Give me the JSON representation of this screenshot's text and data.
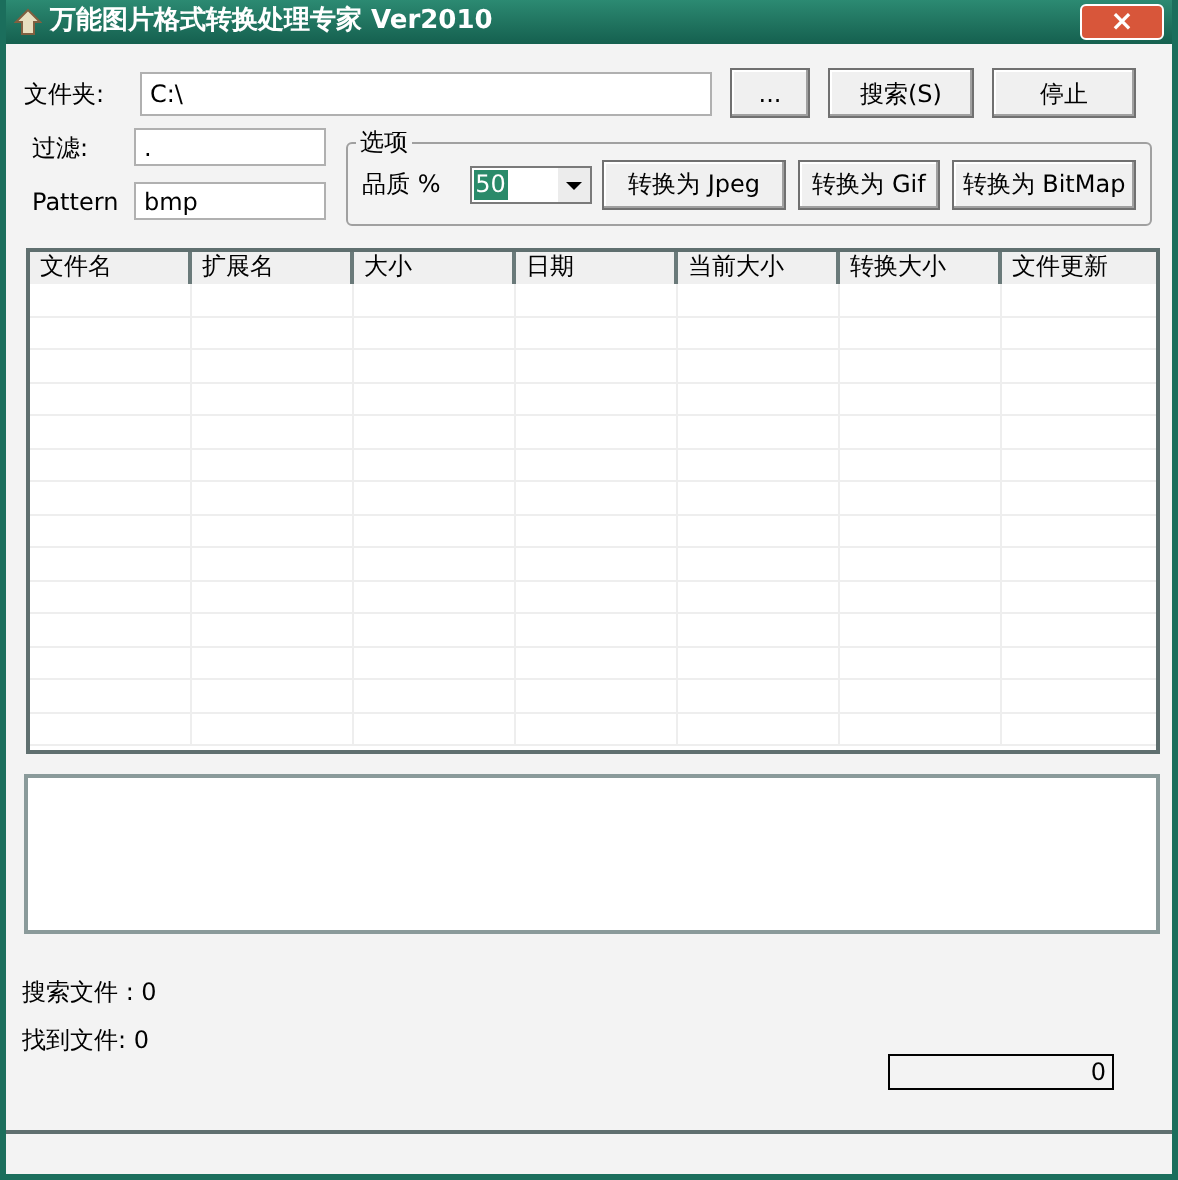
{
  "window": {
    "title": "万能图片格式转换处理专家 Ver2010",
    "close": "×"
  },
  "folder": {
    "label": "文件夹:",
    "value": "C:\\"
  },
  "buttons": [
    {
      "label": "..."
    },
    {
      "label": "搜索(S)"
    },
    {
      "label": "停止"
    }
  ],
  "filter": {
    "label": "过滤:",
    "value": "."
  },
  "pattern": {
    "label": "Pattern",
    "value": "bmp"
  },
  "options": {
    "title": "选项",
    "quality_label": "品质 %",
    "quality": {
      "value": "50",
      "focused": true
    },
    "convert_buttons": [
      {
        "label": "转换为 Jpeg"
      },
      {
        "label": "转换为 Gif"
      },
      {
        "label": "转换为 BitMap"
      }
    ]
  },
  "table": {
    "columns": [
      "文件名",
      "扩展名",
      "大小",
      "日期",
      "当前大小",
      "转换大小",
      "文件更新"
    ]
  },
  "stats": [
    {
      "label": "搜索文件 : 0"
    },
    {
      "label": "找到文件: 0"
    }
  ],
  "progress": {
    "level": 0,
    "reading": "0"
  }
}
